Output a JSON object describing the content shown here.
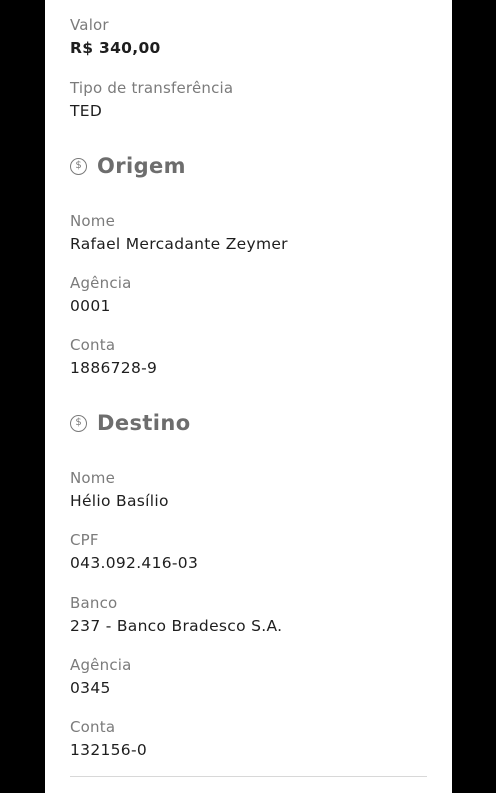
{
  "transfer": {
    "valor_label": "Valor",
    "valor_value": "R$ 340,00",
    "tipo_label": "Tipo de transferência",
    "tipo_value": "TED"
  },
  "origem": {
    "title": "Origem",
    "icon": "dollar-circle-icon",
    "nome_label": "Nome",
    "nome_value": "Rafael Mercadante Zeymer",
    "agencia_label": "Agência",
    "agencia_value": "0001",
    "conta_label": "Conta",
    "conta_value": "1886728-9"
  },
  "destino": {
    "title": "Destino",
    "icon": "dollar-circle-icon",
    "nome_label": "Nome",
    "nome_value": "Hélio Basílio",
    "cpf_label": "CPF",
    "cpf_value": "043.092.416-03",
    "banco_label": "Banco",
    "banco_value": "237 - Banco Bradesco S.A.",
    "agencia_label": "Agência",
    "agencia_value": "0345",
    "conta_label": "Conta",
    "conta_value": "132156-0"
  },
  "colors": {
    "background": "#000000",
    "card": "#ffffff",
    "label": "#7b7b7b",
    "value": "#1e1e1e",
    "section_title": "#6d6d6d"
  }
}
